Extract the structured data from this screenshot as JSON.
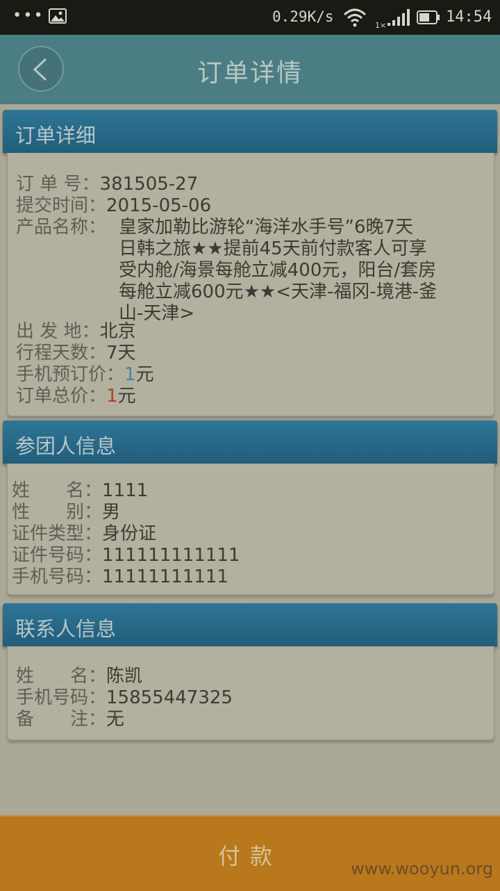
{
  "status_bar": {
    "dots": "•••",
    "net_speed": "0.29K/s",
    "signal_label": "1×",
    "time": "14:54"
  },
  "header": {
    "title": "订单详情"
  },
  "order_section": {
    "title": "订单详细",
    "order_no_label": "订 单 号：",
    "order_no": "381505-27",
    "submit_time_label": "提交时间：",
    "submit_time": "2015-05-06",
    "product_label": "产品名称：",
    "product_lines": [
      "皇家加勒比游轮“海洋水手号”6晚7天",
      "日韩之旅★★提前45天前付款客人可享",
      "受内舱/海景每舱立减400元，阳台/套房",
      "每舱立减600元★★<天津-福冈-境港-釜",
      "山-天津>"
    ],
    "departure_label": "出 发 地：",
    "departure": "北京",
    "days_label": "行程天数：",
    "days": "7天",
    "mobile_price_label": "手机预订价：",
    "mobile_price": "1",
    "mobile_price_unit": "元",
    "total_label": "订单总价：",
    "total": "1",
    "total_unit": "元"
  },
  "participant_section": {
    "title": "参团人信息",
    "name_label": "姓　　名：",
    "name": "1111",
    "gender_label": "性　　别：",
    "gender": "男",
    "id_type_label": "证件类型：",
    "id_type": "身份证",
    "id_no_label": "证件号码：",
    "id_no": "111111111111",
    "phone_label": "手机号码：",
    "phone": "11111111111"
  },
  "contact_section": {
    "title": "联系人信息",
    "name_label": "姓　　名：",
    "name": "陈凯",
    "phone_label": "手机号码：",
    "phone": "15855447325",
    "remark_label": "备　　注：",
    "remark": "无"
  },
  "footer": {
    "pay_label": "付款",
    "watermark": "www.wooyun.org"
  }
}
